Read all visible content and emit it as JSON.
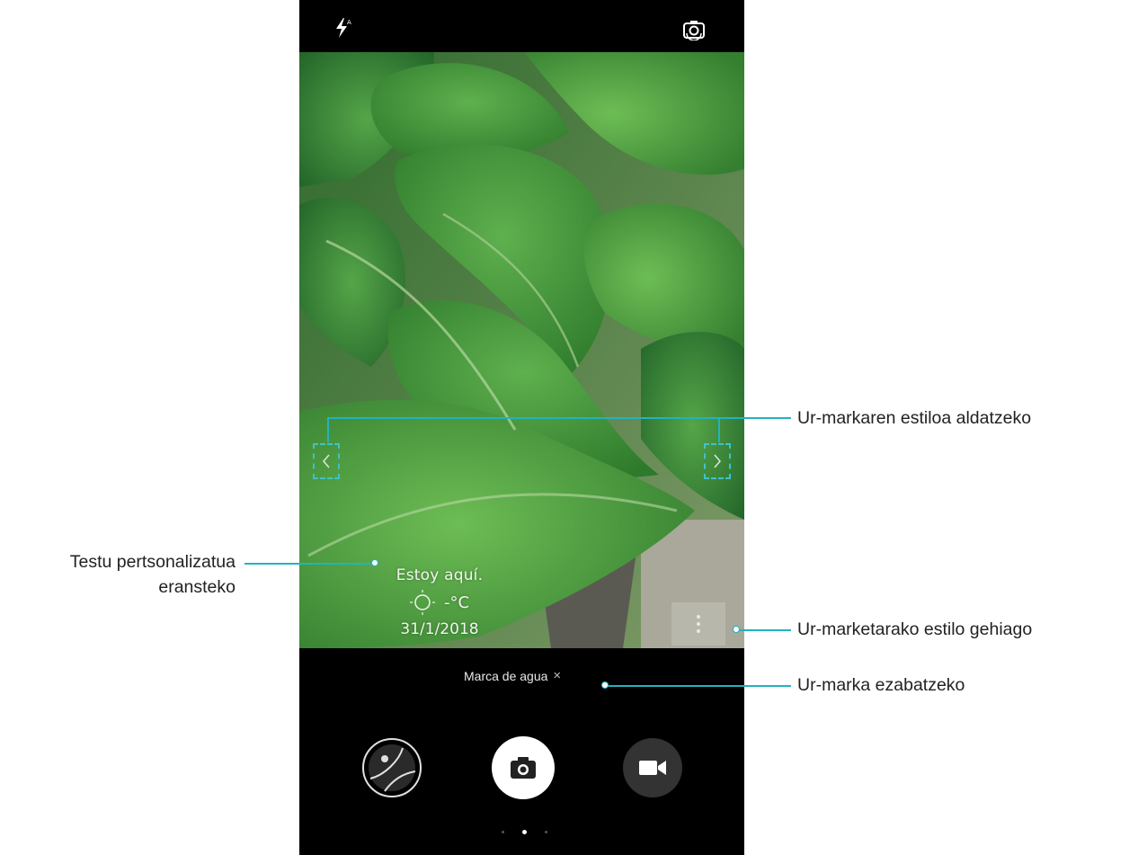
{
  "watermark": {
    "place": "Estoy aquí.",
    "temperature": "-°C",
    "date": "31/1/2018"
  },
  "watermark_chip": {
    "label": "Marca de agua",
    "close": "×"
  },
  "callouts": {
    "change_style": "Ur-markaren estiloa aldatzeko",
    "custom_text_line1": "Testu pertsonalizatua",
    "custom_text_line2": "eransteko",
    "more_styles": "Ur-marketarako estilo gehiago",
    "delete": "Ur-marka ezabatzeko"
  },
  "icons": {
    "flash": "flash-auto-icon",
    "switch_camera": "switch-camera-icon",
    "gallery": "gallery-thumbnail-icon",
    "shutter": "camera-shutter-icon",
    "video": "video-camera-icon",
    "more": "more-vertical-icon",
    "weather": "sun-icon"
  },
  "colors": {
    "callout_line": "#22b3bf",
    "phone_bg": "#000000"
  }
}
